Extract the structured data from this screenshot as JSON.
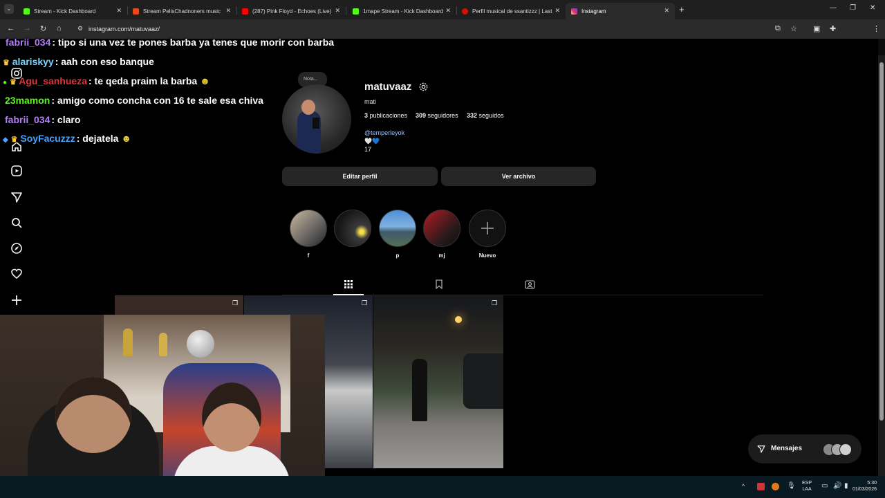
{
  "browser": {
    "tabs": [
      {
        "title": "Stream - Kick Dashboard",
        "color": "#53fc18"
      },
      {
        "title": "Stream PelisChadnoners music",
        "color": "#e64a19"
      },
      {
        "title": "(287) Pink Floyd - Echoes (Live)",
        "color": "#ff0000"
      },
      {
        "title": "1mape Stream - Kick Dashboard",
        "color": "#53fc18"
      },
      {
        "title": "Perfil musical de ssantizzz | Last",
        "color": "#d51007"
      },
      {
        "title": "Instagram",
        "color": "#e1306c"
      }
    ],
    "url": "instagram.com/matuvaaz/"
  },
  "chat": {
    "messages": [
      {
        "user": "fabrii_034",
        "text": ": tipo si una vez te pones barba ya tenes que morir con barba",
        "color": "#b57cff"
      },
      {
        "user": "alariskyy",
        "text": ": aah con eso banque",
        "color": "#7ed6ff"
      },
      {
        "user": "Agu_sanhueza",
        "text": ": te qeda praim la barba",
        "color": "#e0333a"
      },
      {
        "user": "23mamon",
        "text": ": amigo como concha con 16 te sale esa chiva",
        "color": "#53fc18"
      },
      {
        "user": "fabrii_034",
        "text": ": claro",
        "color": "#b57cff"
      },
      {
        "user": "SoyFacuzzz",
        "text": ": dejatela",
        "color": "#4aa3ff"
      }
    ]
  },
  "profile": {
    "note": "Nota...",
    "username": "matuvaaz",
    "name": "mati",
    "posts": "3",
    "posts_label": "publicaciones",
    "followers": "309",
    "followers_label": "seguidores",
    "following": "332",
    "following_label": "seguidos",
    "link": "@temperleyok",
    "bio_hearts": "🤍💙",
    "bio_number": "17",
    "edit_button": "Editar perfil",
    "archive_button": "Ver archivo",
    "highlights": [
      {
        "label": "f"
      },
      {
        "label": ""
      },
      {
        "label": "p"
      },
      {
        "label": "mj"
      },
      {
        "label": "Nuevo"
      }
    ]
  },
  "messages_button": {
    "label": "Mensajes"
  },
  "taskbar": {
    "lang": "ESP",
    "lang2": "LAA",
    "time": "5:30",
    "date": "01/03/2026"
  }
}
